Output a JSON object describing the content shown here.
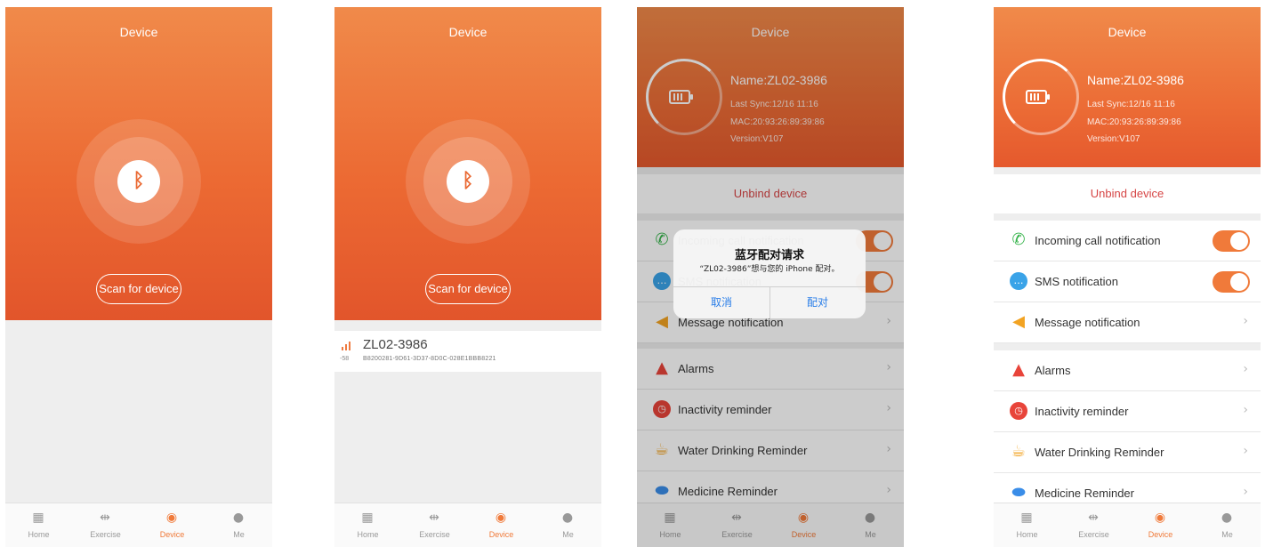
{
  "screen1": {
    "title": "Device",
    "bluetooth_icon": "bluetooth-icon",
    "scan_label": "Scan for device"
  },
  "screen2": {
    "title": "Device",
    "bluetooth_icon": "bluetooth-icon",
    "scan_label": "Scan for device",
    "device": {
      "name": "ZL02-3986",
      "rssi": "-58",
      "uuid": "B8200281-9D61-3D37-8D0C-028E1BBB8221"
    }
  },
  "device_info": {
    "title": "Device",
    "name": "Name:ZL02-3986",
    "last_sync": "Last Sync:12/16 11:16",
    "mac": "MAC:20:93:26:89:39:86",
    "version": "Version:V107",
    "unbind_label": "Unbind device",
    "settings": [
      {
        "label": "Incoming call notification",
        "icon": "phone-icon",
        "control": "toggle",
        "on": true
      },
      {
        "label": "SMS notification",
        "icon": "sms-icon",
        "control": "toggle",
        "on": true
      },
      {
        "label": "Message notification",
        "icon": "speaker-icon",
        "control": "chevron"
      },
      {
        "label": "Alarms",
        "icon": "bell-icon",
        "control": "chevron"
      },
      {
        "label": "Inactivity reminder",
        "icon": "clock-icon",
        "control": "chevron"
      },
      {
        "label": "Water Drinking Reminder",
        "icon": "cup-icon",
        "control": "chevron"
      },
      {
        "label": "Medicine Reminder",
        "icon": "pill-icon",
        "control": "chevron"
      }
    ]
  },
  "pair_dialog": {
    "title": "蓝牙配对请求",
    "message": "“ZL02-3986”想与您的 iPhone 配对。",
    "cancel": "取消",
    "pair": "配对"
  },
  "tabbar": {
    "items": [
      {
        "label": "Home",
        "icon": "grid-icon"
      },
      {
        "label": "Exercise",
        "icon": "dumbbell-icon"
      },
      {
        "label": "Device",
        "icon": "watch-icon"
      },
      {
        "label": "Me",
        "icon": "person-icon"
      }
    ],
    "active": "Device"
  },
  "colors": {
    "accent": "#f07a3a",
    "unbind": "#d64545",
    "dialog_button": "#2a7ee8"
  }
}
